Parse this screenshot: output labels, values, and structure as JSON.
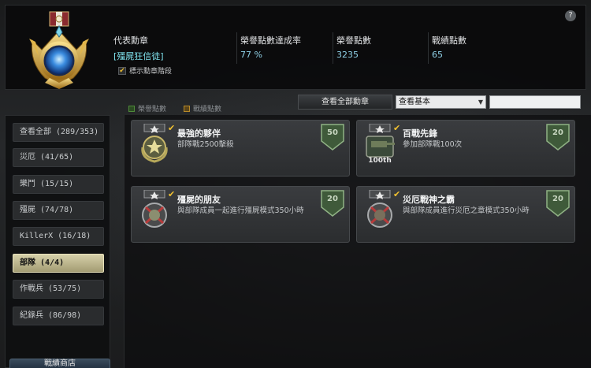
{
  "help_label": "?",
  "profile": {
    "rep_medal_label": "代表勳章",
    "rep_medal_value": "[殭屍狂信徒]",
    "honor_rate_label": "榮譽點數達成率",
    "honor_rate_value": "77 %",
    "honor_points_label": "榮譽點數",
    "honor_points_value": "3235",
    "battle_points_label": "戰績點數",
    "battle_points_value": "65",
    "show_stage_label": "標示勳章階段",
    "show_stage_checked": true
  },
  "legend": {
    "honor_label": "榮譽點數",
    "honor_color": "#4f8a3a",
    "battle_label": "戰績點數",
    "battle_color": "#b88a2a"
  },
  "toolbar": {
    "view_all_label": "查看全部勳章",
    "filter_selected": "查看基本",
    "search_value": ""
  },
  "categories": [
    {
      "label": "查看全部 (289/353)",
      "active": false
    },
    {
      "label": "災厄 (41/65)",
      "active": false
    },
    {
      "label": "樂鬥 (15/15)",
      "active": false
    },
    {
      "label": "殭屍 (74/78)",
      "active": false
    },
    {
      "label": "KillerX (16/18)",
      "active": false
    },
    {
      "label": "部隊 (4/4)",
      "active": true
    },
    {
      "label": "作戰兵 (53/75)",
      "active": false
    },
    {
      "label": "紀錄兵 (86/98)",
      "active": false
    }
  ],
  "bottom_button_label": "戰績商店",
  "medals": [
    {
      "title": "最強的夥伴",
      "desc": "部隊戰2500擊殺",
      "points": "50",
      "icon": "star-wreath-medal-icon"
    },
    {
      "title": "百戰先鋒",
      "desc": "參加部隊戰100次",
      "points": "20",
      "icon": "tank-100-medal-icon"
    },
    {
      "title": "殭屍的朋友",
      "desc": "與部隊成員一起進行殭屍模式350小時",
      "points": "20",
      "icon": "zombie-badge-icon"
    },
    {
      "title": "災厄戰神之霸",
      "desc": "與部隊成員進行災厄之章模式350小時",
      "points": "20",
      "icon": "disaster-badge-icon"
    }
  ],
  "colors": {
    "accent_cyan": "#8fd0e6",
    "active_category": "#d6d0a9",
    "check": "#f0c030"
  }
}
